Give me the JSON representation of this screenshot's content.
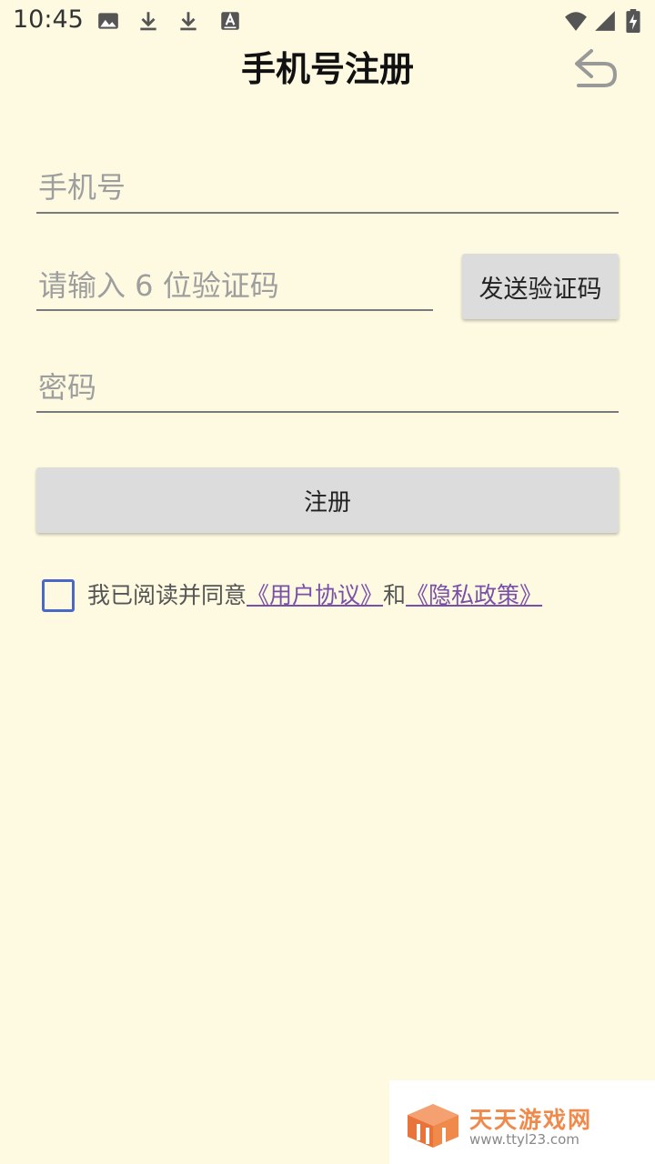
{
  "status_bar": {
    "time": "10:45",
    "left_icons": [
      "image-icon",
      "download-icon",
      "download-icon",
      "font-icon"
    ],
    "right_icons": [
      "wifi-icon",
      "signal-icon",
      "battery-charging-icon"
    ]
  },
  "header": {
    "title": "手机号注册",
    "back_icon": "undo-arrow-icon"
  },
  "form": {
    "phone_placeholder": "手机号",
    "code_placeholder": "请输入 6 位验证码",
    "send_code_label": "发送验证码",
    "password_placeholder": "密码",
    "register_label": "注册"
  },
  "agreement": {
    "checked": false,
    "prefix": "我已阅读并同意",
    "user_agreement": "《用户协议》",
    "conjunction": "和",
    "privacy_policy": "《隐私政策》"
  },
  "watermark": {
    "title": "天天游戏网",
    "url": "www.ttyl23.com"
  },
  "colors": {
    "background": "#fdfae1",
    "button": "#dcdcdc",
    "checkbox": "#4a68c8",
    "link": "#7a4fa8",
    "watermark_accent": "#f08a4b"
  }
}
